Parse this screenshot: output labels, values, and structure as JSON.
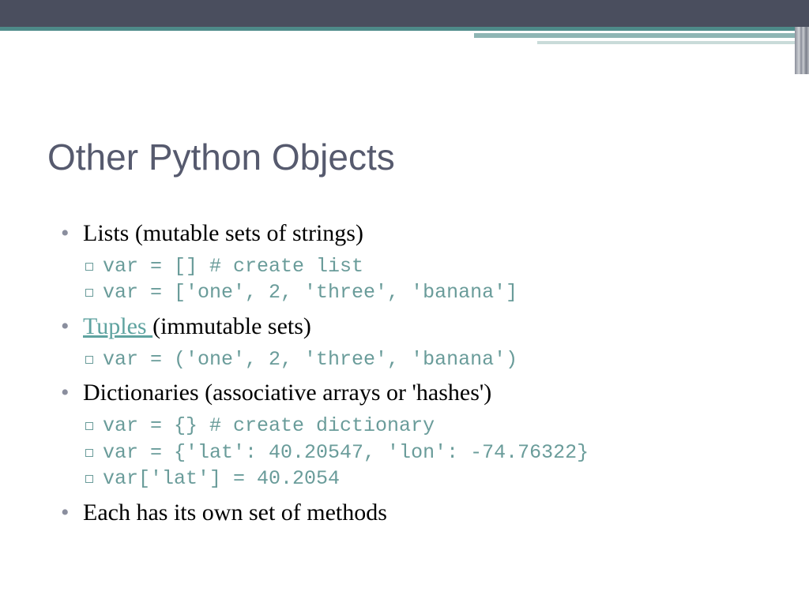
{
  "title": "Other Python Objects",
  "bullet1": {
    "text": "Lists (mutable sets of strings)",
    "code": [
      "var = [] # create list",
      "var = ['one', 2, 'three', 'banana']"
    ]
  },
  "bullet2": {
    "link": "Tuples ",
    "rest": "(immutable sets)",
    "code": [
      "var = ('one', 2, 'three', 'banana')"
    ]
  },
  "bullet3": {
    "text": "Dictionaries (associative arrays or 'hashes')",
    "code": [
      "var = {} # create dictionary",
      "var = {'lat': 40.20547, 'lon': -74.76322}",
      "var['lat'] = 40.2054"
    ]
  },
  "bullet4": {
    "text": "Each has its own set of methods"
  }
}
